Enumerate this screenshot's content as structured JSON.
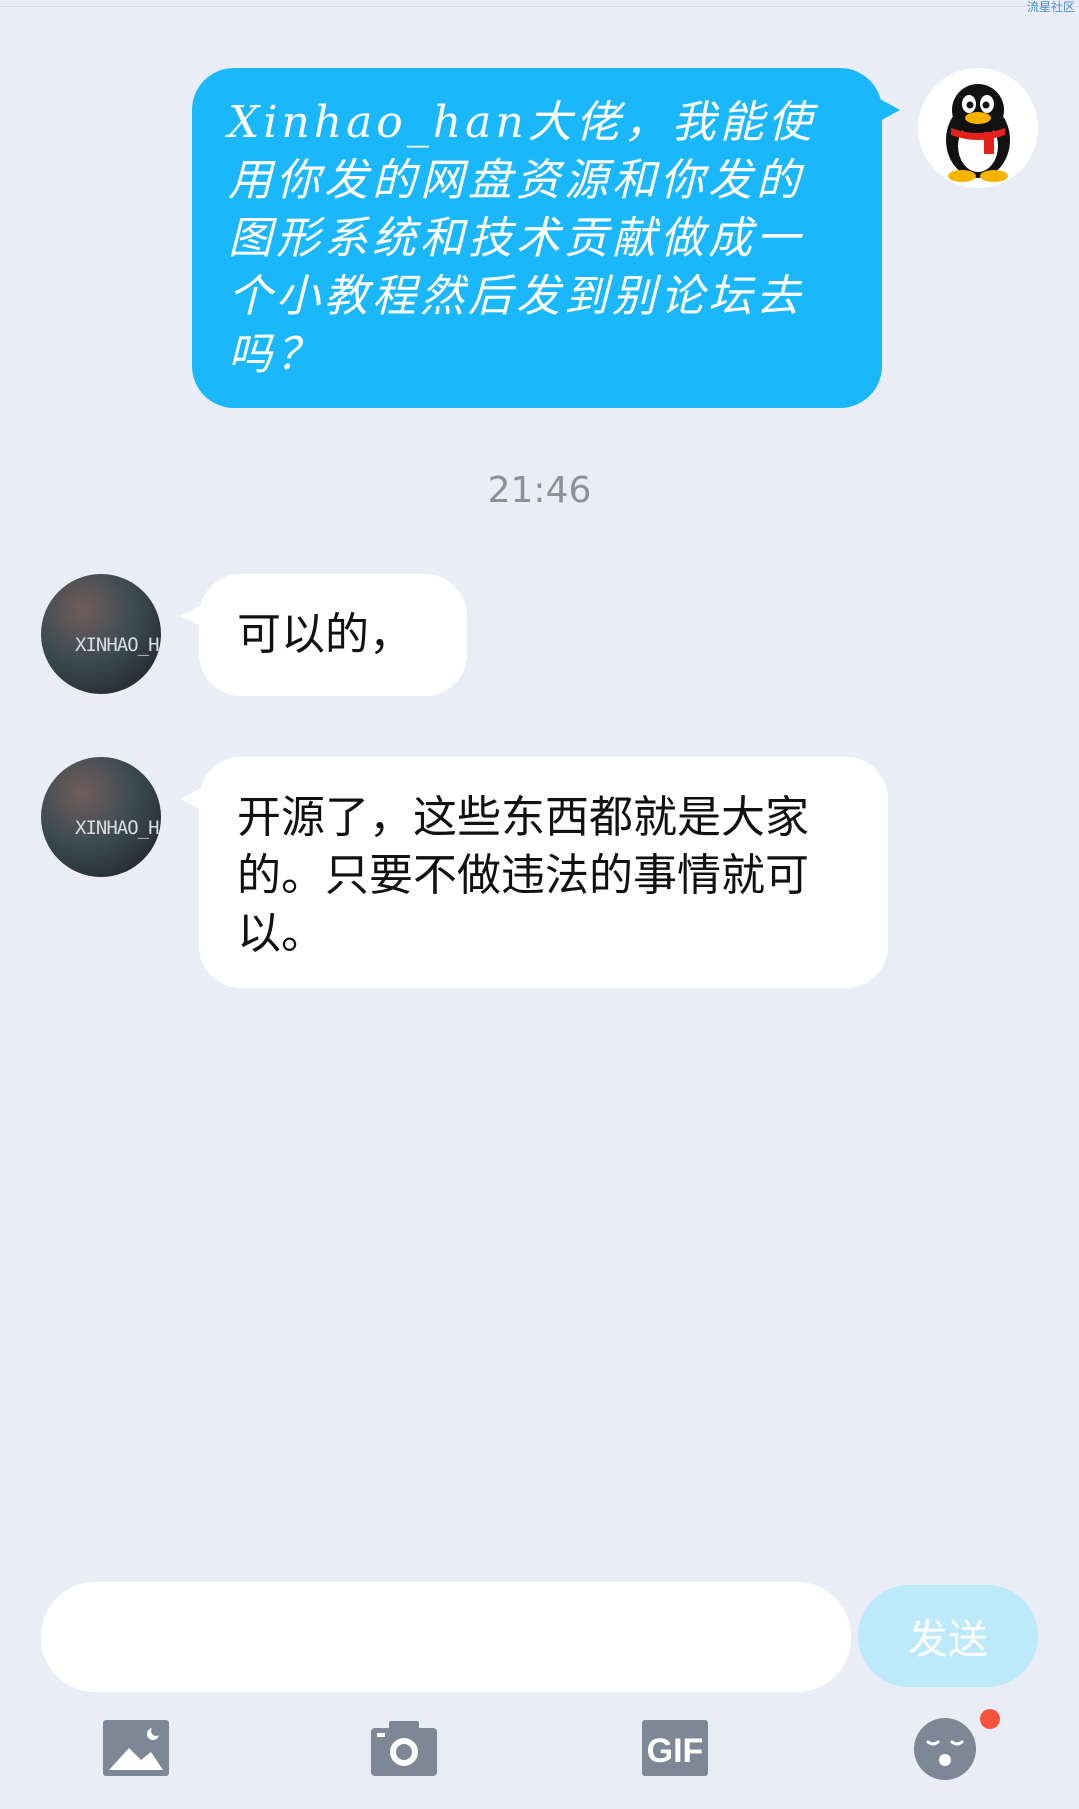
{
  "watermark": "流星社区",
  "messages": [
    {
      "sender": "self",
      "text": "Xinhao_han大佬，我能使用你发的网盘资源和你发的图形系统和技术贡献做成一个小教程然后发到别论坛去吗？"
    },
    {
      "sender": "other",
      "text": "可以的，"
    },
    {
      "sender": "other",
      "text": "开源了，这些东西都就是大家的。只要不做违法的事情就可以。"
    }
  ],
  "timestamp": "21:46",
  "other_avatar_text": "XINHAO_HAN",
  "composer": {
    "input_value": "",
    "send_label": "发送"
  },
  "toolbar": [
    {
      "icon": "image-icon"
    },
    {
      "icon": "camera-icon"
    },
    {
      "icon": "gif-icon",
      "label": "GIF"
    },
    {
      "icon": "emoji-icon",
      "badge": "red-dot"
    }
  ],
  "colors": {
    "background": "#eaedf5",
    "outgoing_bubble": "#1ab8fa",
    "incoming_bubble": "#ffffff",
    "send_button": "#bdeafa",
    "toolbar_icons": "#7d8796",
    "badge": "#f4543c"
  }
}
